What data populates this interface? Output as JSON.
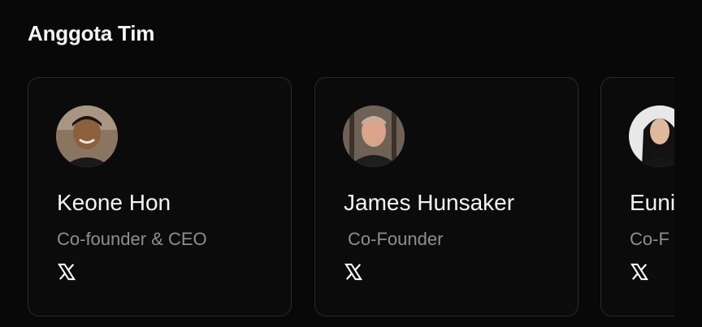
{
  "section": {
    "title": "Anggota Tim"
  },
  "members": [
    {
      "name": "Keone Hon",
      "role": "Co-founder & CEO",
      "social_icon": "x-logo-icon",
      "avatar": "photo-man-smiling"
    },
    {
      "name": "James Hunsaker",
      "role": "Co-Founder",
      "social_icon": "x-logo-icon",
      "avatar": "photo-man-grey-hair"
    },
    {
      "name": "Euni",
      "role": "Co-F",
      "social_icon": "x-logo-icon",
      "avatar": "photo-woman-long-hair"
    }
  ],
  "colors": {
    "background": "#080808",
    "card_border": "#2a2a2a",
    "name_text": "#f4f4f4",
    "role_text": "#8e8e8e"
  }
}
